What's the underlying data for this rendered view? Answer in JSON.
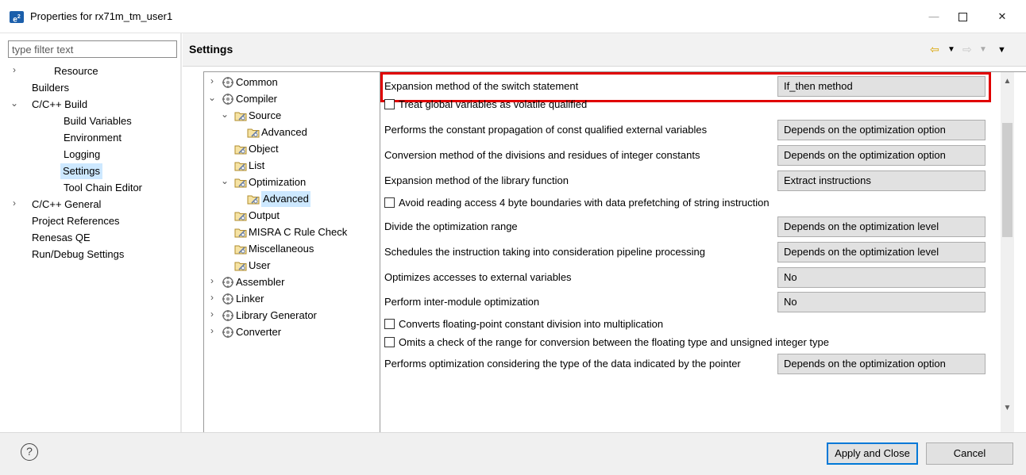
{
  "window": {
    "title": "Properties for rx71m_tm_user1",
    "app_icon": "e²",
    "controls": {
      "minimize": "—",
      "maximize": "☐",
      "close": "✕"
    }
  },
  "filter": {
    "placeholder": "type filter text",
    "value": ""
  },
  "left_nav": {
    "items": [
      {
        "label": "Resource",
        "twisty": "›"
      },
      {
        "label": "Builders",
        "twisty": ""
      },
      {
        "label": "C/C++ Build",
        "twisty": "⌄"
      },
      {
        "label": "Build Variables",
        "twisty": ""
      },
      {
        "label": "Environment",
        "twisty": ""
      },
      {
        "label": "Logging",
        "twisty": ""
      },
      {
        "label": "Settings",
        "twisty": "",
        "selected": true
      },
      {
        "label": "Tool Chain Editor",
        "twisty": ""
      },
      {
        "label": "C/C++ General",
        "twisty": "›"
      },
      {
        "label": "Project References",
        "twisty": ""
      },
      {
        "label": "Renesas QE",
        "twisty": ""
      },
      {
        "label": "Run/Debug Settings",
        "twisty": ""
      }
    ]
  },
  "settings": {
    "title": "Settings",
    "nav_icons": {
      "back": "⇦",
      "back_dropdown": "▼",
      "forward": "⇨",
      "forward_dropdown": "▼",
      "view_menu": "▼"
    }
  },
  "tool_tree": {
    "items": [
      {
        "label": "Common",
        "twisty": "›",
        "icon": "tool-gear-icon"
      },
      {
        "label": "Compiler",
        "twisty": "⌄",
        "icon": "tool-gear-icon"
      },
      {
        "label": "Source",
        "twisty": "⌄",
        "icon": "options-folder-icon"
      },
      {
        "label": "Advanced",
        "twisty": "",
        "icon": "options-folder-icon"
      },
      {
        "label": "Object",
        "twisty": "",
        "icon": "options-folder-icon"
      },
      {
        "label": "List",
        "twisty": "",
        "icon": "options-folder-icon"
      },
      {
        "label": "Optimization",
        "twisty": "⌄",
        "icon": "options-folder-icon"
      },
      {
        "label": "Advanced",
        "twisty": "",
        "icon": "options-folder-icon",
        "selected": true
      },
      {
        "label": "Output",
        "twisty": "",
        "icon": "options-folder-icon"
      },
      {
        "label": "MISRA C Rule Check",
        "twisty": "",
        "icon": "options-folder-icon"
      },
      {
        "label": "Miscellaneous",
        "twisty": "",
        "icon": "options-folder-icon"
      },
      {
        "label": "User",
        "twisty": "",
        "icon": "options-folder-icon"
      },
      {
        "label": "Assembler",
        "twisty": "›",
        "icon": "tool-gear-icon"
      },
      {
        "label": "Linker",
        "twisty": "›",
        "icon": "tool-gear-icon"
      },
      {
        "label": "Library Generator",
        "twisty": "›",
        "icon": "tool-gear-icon"
      },
      {
        "label": "Converter",
        "twisty": "›",
        "icon": "tool-gear-icon"
      }
    ]
  },
  "options": [
    {
      "kind": "combo",
      "label": "Expansion method of the switch statement",
      "value": "If_then method",
      "highlighted": true
    },
    {
      "kind": "check",
      "label": "Treat global variables as volatile qualified",
      "checked": false
    },
    {
      "kind": "combo",
      "label": "Performs the constant propagation of const qualified external variables",
      "value": "Depends on the optimization option"
    },
    {
      "kind": "combo",
      "label": "Conversion method of the divisions and residues of integer constants",
      "value": "Depends on the optimization option"
    },
    {
      "kind": "combo",
      "label": "Expansion method of the library function",
      "value": "Extract instructions"
    },
    {
      "kind": "check",
      "label": "Avoid reading access 4 byte boundaries with data prefetching of string instruction",
      "checked": false
    },
    {
      "kind": "combo",
      "label": "Divide the optimization range",
      "value": "Depends on the optimization level"
    },
    {
      "kind": "combo",
      "label": "Schedules the instruction taking into consideration pipeline processing",
      "value": "Depends on the optimization level"
    },
    {
      "kind": "combo",
      "label": "Optimizes accesses to external variables",
      "value": "No"
    },
    {
      "kind": "combo",
      "label": "Perform inter-module optimization",
      "value": "No"
    },
    {
      "kind": "check",
      "label": "Converts floating-point constant division into multiplication",
      "checked": false
    },
    {
      "kind": "check",
      "label": "Omits a check of the range for conversion between the floating type and unsigned integer type",
      "checked": false
    },
    {
      "kind": "combo",
      "label": "Performs optimization considering the type of the data indicated by the pointer",
      "value": "Depends on the optimization option"
    }
  ],
  "scrollbar": {
    "up": "▲",
    "down": "▼"
  },
  "footer": {
    "help_icon": "?",
    "apply_label": "Apply and Close",
    "cancel_label": "Cancel"
  },
  "colors": {
    "highlight": "#e00000",
    "selection": "#cde8ff",
    "default_button_border": "#0078d7"
  }
}
